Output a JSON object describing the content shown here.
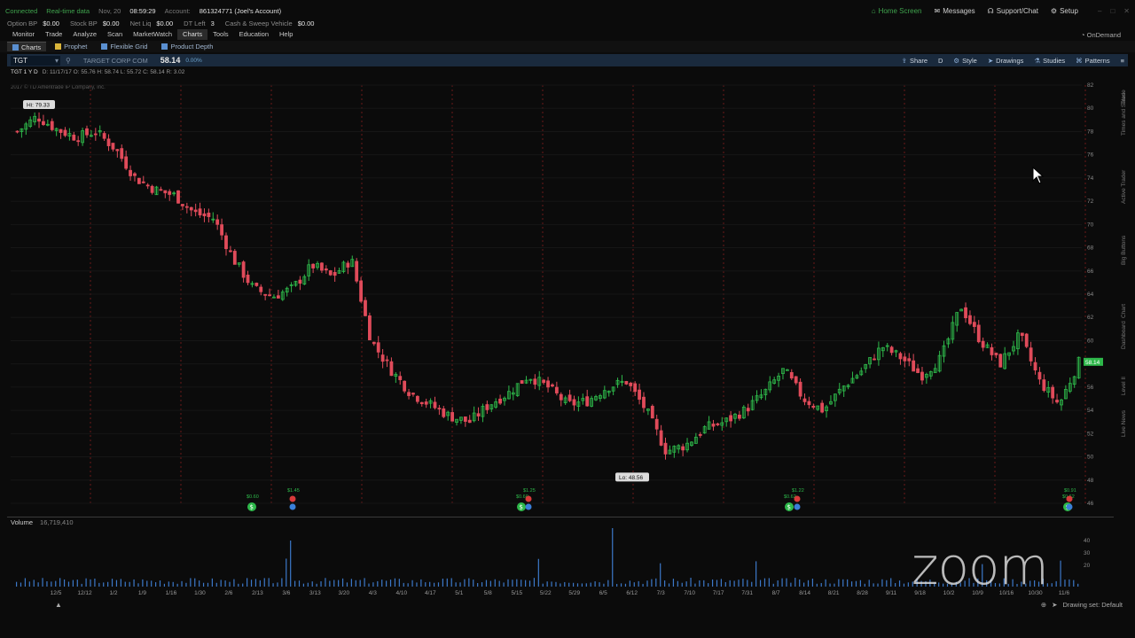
{
  "status": {
    "connected": "Connected",
    "realtime": "Real-time data",
    "date_label": "Nov, 20",
    "time": "08:59:29",
    "account_label": "Account:",
    "account": "861324771 (Joel's Account)",
    "home_screen": "Home Screen",
    "messages": "Messages",
    "support": "Support/Chat",
    "setup": "Setup"
  },
  "bp": [
    {
      "label": "Option BP",
      "value": "$0.00"
    },
    {
      "label": "Stock BP",
      "value": "$0.00"
    },
    {
      "label": "Net Liq",
      "value": "$0.00"
    },
    {
      "label": "DT Left",
      "value": "3"
    },
    {
      "label": "Cash & Sweep Vehicle",
      "value": "$0.00"
    }
  ],
  "menu": [
    "Monitor",
    "Trade",
    "Analyze",
    "Scan",
    "MarketWatch",
    "Charts",
    "Tools",
    "Education",
    "Help"
  ],
  "menu_active": "Charts",
  "ondemand": "OnDemand",
  "subtabs": [
    {
      "label": "Charts",
      "icon": "chart-icon"
    },
    {
      "label": "Prophet",
      "icon": "prophet-icon"
    },
    {
      "label": "Flexible Grid",
      "icon": "grid-icon"
    },
    {
      "label": "Product Depth",
      "icon": "depth-icon"
    }
  ],
  "chart_header": {
    "symbol": "TGT",
    "name": "TARGET CORP COM",
    "last": "58.14",
    "change": "0.00%",
    "tools": [
      "Share",
      "D",
      "Style",
      "Drawings",
      "Studies",
      "Patterns"
    ]
  },
  "ohlc": {
    "symbol": "TGT 1 Y D",
    "text": "D: 11/17/17   O: 55.76   H: 58.74   L: 55.72   C: 58.14   R: 3.02"
  },
  "copyright": "2017 © TD Ameritrade IP Company, Inc.",
  "volume": {
    "label": "Volume",
    "value": "16,719,410"
  },
  "drawing_set": "Drawing set: Default",
  "side_tabs": [
    "Trade",
    "Times and Sales",
    "Active Trader",
    "Big Buttons",
    "Chart",
    "Dashboard",
    "Level II",
    "Live News"
  ],
  "watermark": "zoom",
  "chart_data": {
    "type": "candlestick",
    "title": "",
    "ylim": [
      46,
      82
    ],
    "yticks": [
      82,
      80,
      78,
      76,
      74,
      72,
      70,
      68,
      66,
      64,
      62,
      60,
      58,
      56,
      54,
      52,
      50,
      48,
      46
    ],
    "x_labels": [
      "12/5",
      "12/12",
      "1/2",
      "1/9",
      "1/16",
      "1/30",
      "2/6",
      "2/13",
      "3/6",
      "3/13",
      "3/20",
      "4/3",
      "4/10",
      "4/17",
      "5/1",
      "5/8",
      "5/15",
      "5/22",
      "5/29",
      "6/5",
      "6/12",
      "7/3",
      "7/10",
      "7/17",
      "7/31",
      "8/7",
      "8/14",
      "8/21",
      "8/28",
      "9/11",
      "9/18",
      "10/2",
      "10/9",
      "10/16",
      "10/30",
      "11/6"
    ],
    "high_label": "Hi: 79.33",
    "low_label": "Lo: 48.56",
    "last_label": "58.14",
    "dividends": [
      "$0.60",
      "$0.60",
      "$0.62",
      "$0.62"
    ],
    "earnings": [
      "$1.45",
      "$1.25",
      "$1.22",
      "$0.91"
    ],
    "path": [
      78,
      79.3,
      78.2,
      77.5,
      78,
      76.5,
      74,
      73,
      72.5,
      71,
      70.5,
      67,
      64.5,
      63.8,
      64.5,
      66.5,
      65.5,
      67,
      60,
      57.5,
      55.5,
      54.5,
      53.5,
      53,
      54.5,
      55.5,
      57,
      56,
      54.5,
      54.8,
      56,
      56.5,
      54,
      50.5,
      51,
      52.5,
      53,
      54,
      55.5,
      57.5,
      55,
      54,
      56,
      57.5,
      59.5,
      58.5,
      57,
      58.5,
      63,
      60,
      58,
      60.5,
      56.5,
      54.5,
      58.14
    ]
  }
}
